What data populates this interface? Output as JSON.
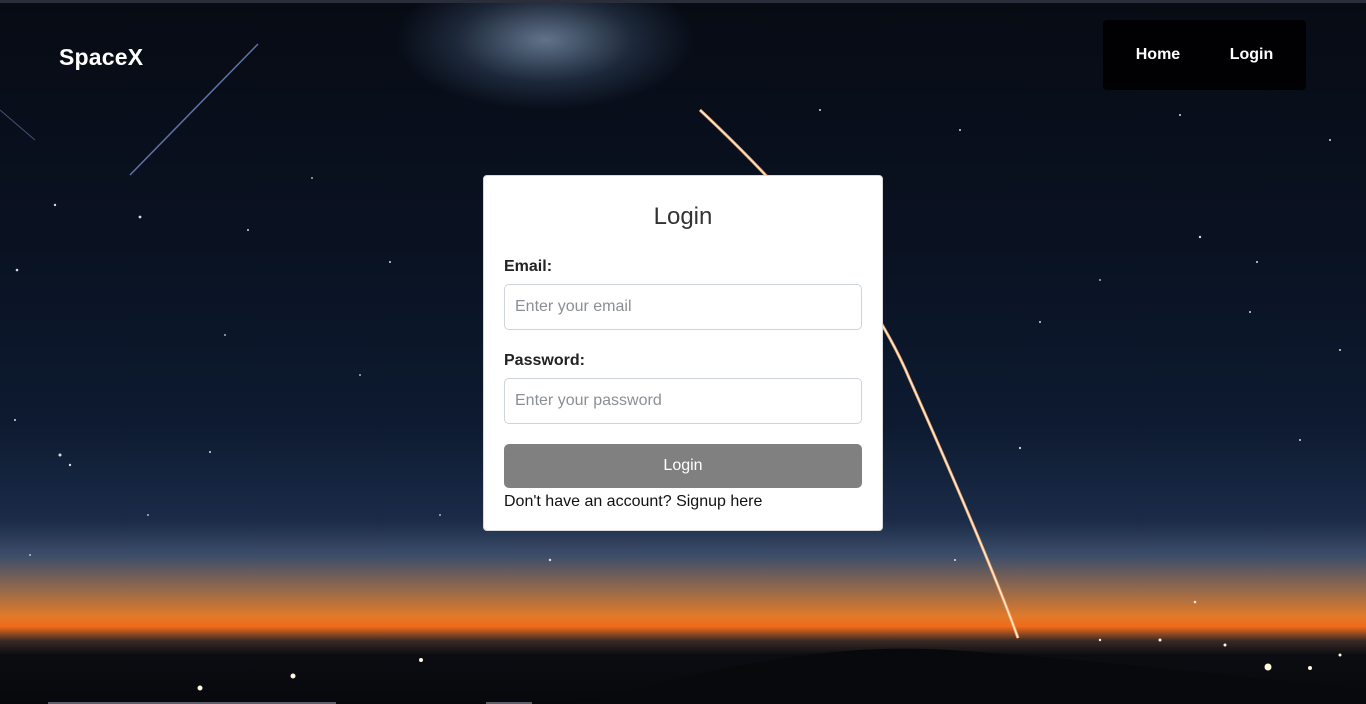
{
  "brand": "SpaceX",
  "nav": {
    "home": "Home",
    "login": "Login"
  },
  "login_form": {
    "title": "Login",
    "email_label": "Email:",
    "email_placeholder": "Enter your email",
    "password_label": "Password:",
    "password_placeholder": "Enter your password",
    "submit_label": "Login",
    "signup_text": "Don't have an account? Signup here"
  },
  "colors": {
    "button_bg": "#808080",
    "nav_bg": "#000000",
    "card_bg": "#ffffff"
  }
}
